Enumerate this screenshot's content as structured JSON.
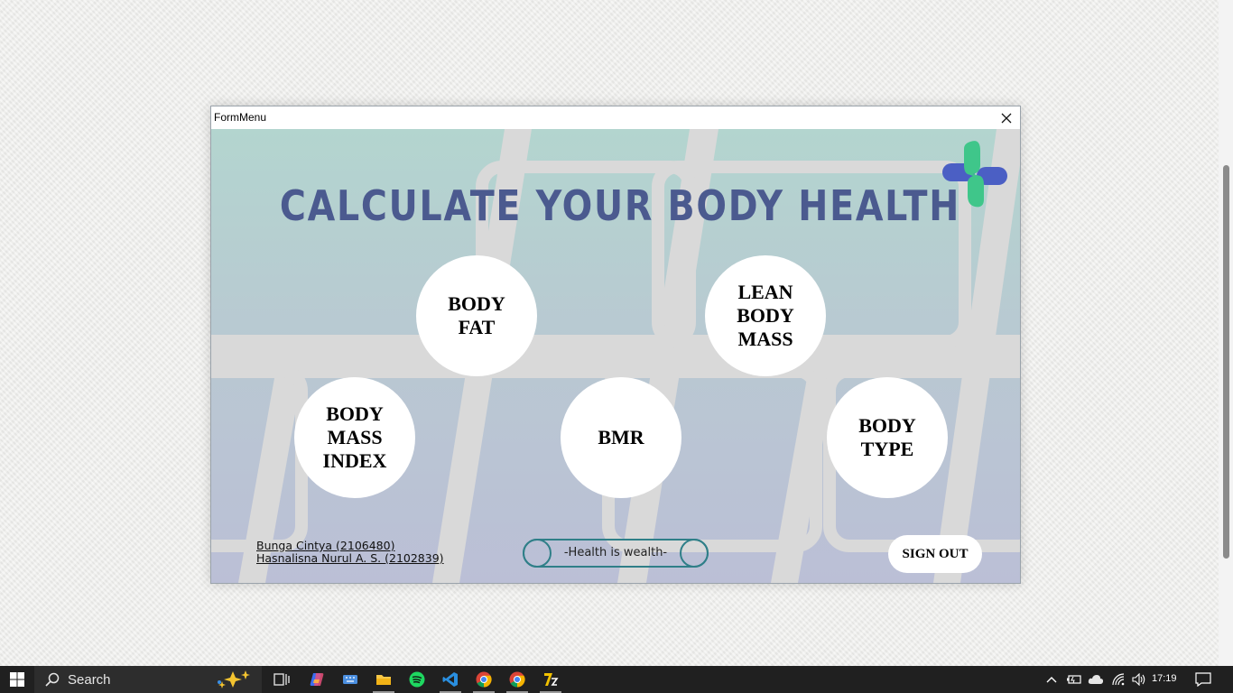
{
  "window": {
    "title": "FormMenu"
  },
  "app": {
    "heading": "CALCULATE YOUR BODY HEALTH",
    "buttons": {
      "body_fat": "BODY\nFAT",
      "lean_body_mass": "LEAN\nBODY\nMASS",
      "body_mass_index": "BODY\nMASS\nINDEX",
      "bmr": "BMR",
      "body_type": "BODY\nTYPE"
    },
    "credits": [
      "Bunga Cintya (2106480)",
      "Hasnalisna Nurul A. S. (2102839)"
    ],
    "motto": "-Health is wealth-",
    "sign_out": "SIGN OUT"
  },
  "taskbar": {
    "search_label": "Search",
    "time": "17:19"
  },
  "colors": {
    "heading": "#4b5a8f",
    "logo_green": "#3fc68a",
    "logo_blue": "#4b5fc4",
    "motto_border": "#2f7f88"
  }
}
